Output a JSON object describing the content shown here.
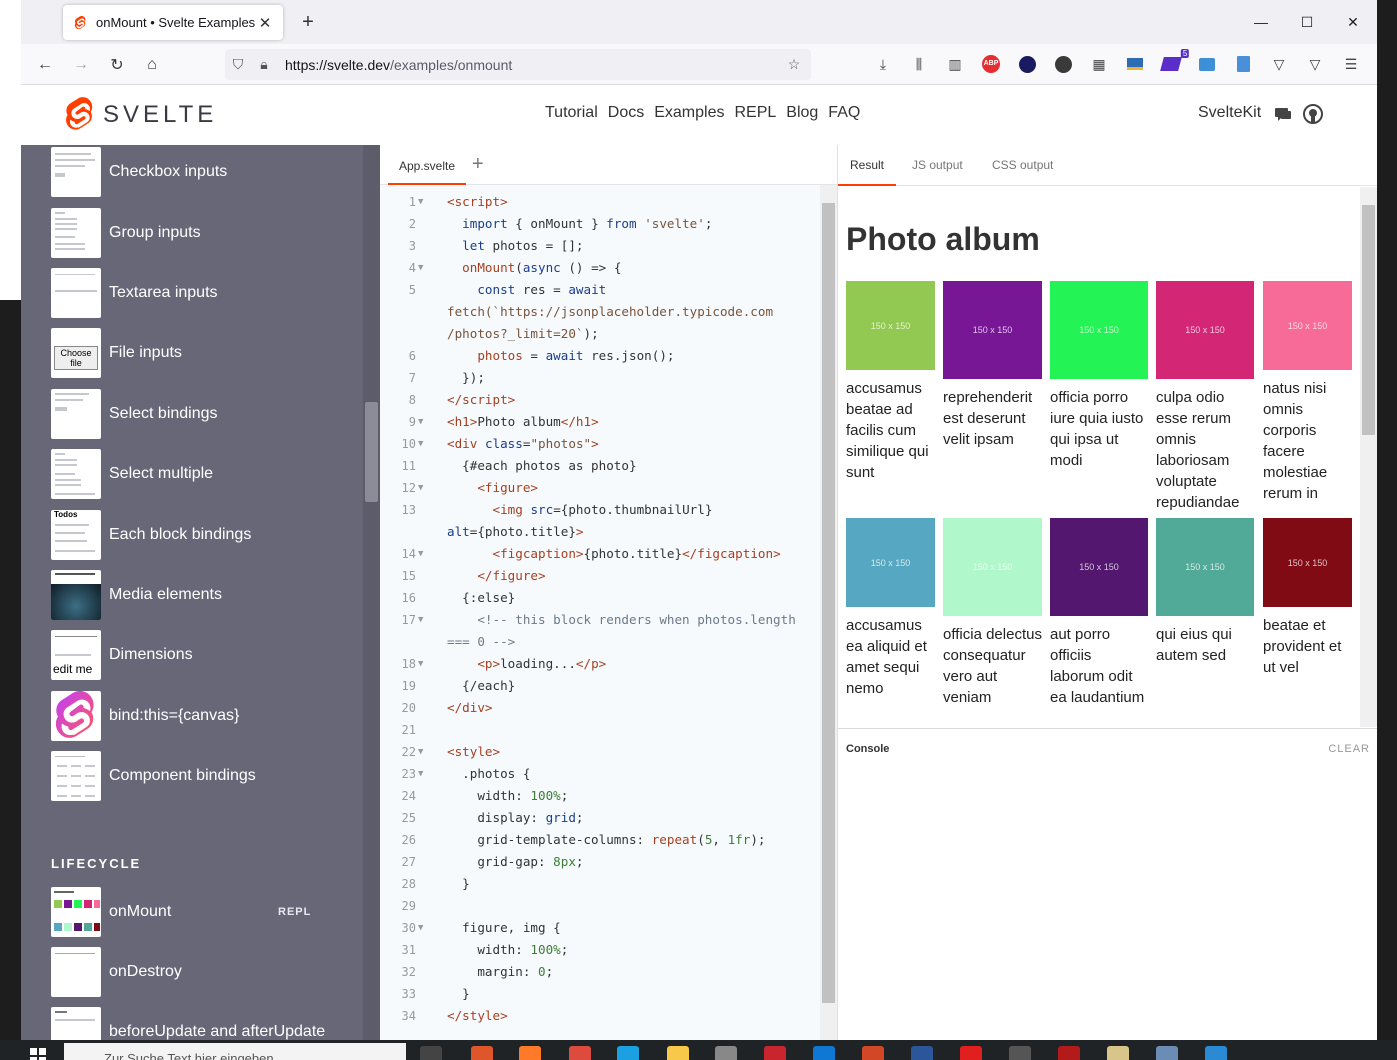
{
  "browser": {
    "tab_title": "onMount • Svelte Examples",
    "new_tab": "+",
    "url_host": "https://svelte.dev",
    "url_path": "/examples/onmount",
    "toolbar_badge": "5"
  },
  "site": {
    "logo_text": "SVELTE",
    "nav": [
      "Tutorial",
      "Docs",
      "Examples",
      "REPL",
      "Blog",
      "FAQ"
    ],
    "kit": "SvelteKit"
  },
  "sidebar": {
    "items": [
      {
        "label": "Checkbox inputs"
      },
      {
        "label": "Group inputs"
      },
      {
        "label": "Textarea inputs"
      },
      {
        "label": "File inputs",
        "thumb_text": "Choose file"
      },
      {
        "label": "Select bindings"
      },
      {
        "label": "Select multiple"
      },
      {
        "label": "Each block bindings",
        "thumb_text": "Todos"
      },
      {
        "label": "Media elements"
      },
      {
        "label": "Dimensions",
        "thumb_text": "edit me"
      },
      {
        "label": "bind:this={canvas}"
      },
      {
        "label": "Component bindings"
      }
    ],
    "section": "LIFECYCLE",
    "lifecycle": [
      {
        "label": "onMount",
        "badge": "REPL"
      },
      {
        "label": "onDestroy"
      },
      {
        "label": "beforeUpdate and afterUpdate"
      }
    ]
  },
  "editor": {
    "file_tab": "App.svelte",
    "add_tab": "+"
  },
  "result": {
    "tabs": [
      "Result",
      "JS output",
      "CSS output"
    ],
    "title": "Photo album",
    "placeholder": "150 x 150",
    "photos": [
      {
        "caption": "accusamus beatae ad facilis cum similique qui sunt",
        "color": "#92c952"
      },
      {
        "caption": "reprehenderit est deserunt velit ipsam",
        "color": "#771796"
      },
      {
        "caption": "officia porro iure quia iusto qui ipsa ut modi",
        "color": "#24f355"
      },
      {
        "caption": "culpa odio esse rerum omnis laboriosam voluptate repudiandae",
        "color": "#d32776"
      },
      {
        "caption": "natus nisi omnis corporis facere molestiae rerum in",
        "color": "#f66b97"
      },
      {
        "caption": "accusamus ea aliquid et amet sequi nemo",
        "color": "#56a8c2"
      },
      {
        "caption": "officia delectus consequatur vero aut veniam",
        "color": "#b0f7cc"
      },
      {
        "caption": "aut porro officiis laborum odit ea laudantium",
        "color": "#54176f"
      },
      {
        "caption": "qui eius qui autem sed",
        "color": "#51aa97"
      },
      {
        "caption": "beatae et provident et ut vel",
        "color": "#810b14"
      }
    ],
    "console_label": "Console",
    "console_clear": "CLEAR"
  },
  "taskbar": {
    "search_placeholder": "Zur Suche Text hier eingeben"
  }
}
